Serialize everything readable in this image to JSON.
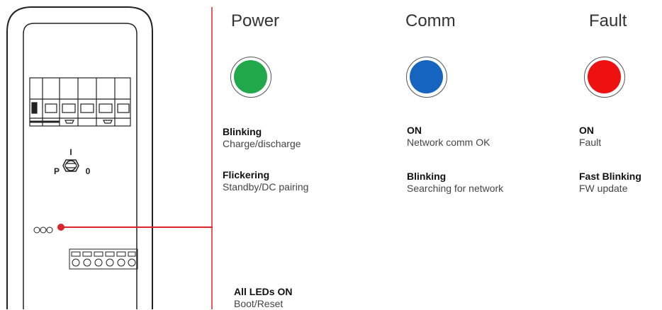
{
  "device": {
    "switch_labels": {
      "top": "I",
      "left": "P",
      "right": "0"
    }
  },
  "columns": [
    {
      "title": "Power",
      "led_color": "#20a84a",
      "states": [
        {
          "heading": "Blinking",
          "desc": "Charge/discharge"
        },
        {
          "heading": "Flickering",
          "desc": "Standby/DC pairing"
        }
      ]
    },
    {
      "title": "Comm",
      "led_color": "#1565c0",
      "states": [
        {
          "heading": "ON",
          "desc": "Network comm OK"
        },
        {
          "heading": "Blinking",
          "desc": "Searching for network"
        }
      ]
    },
    {
      "title": "Fault",
      "led_color": "#ee1111",
      "states": [
        {
          "heading": "ON",
          "desc": "Fault"
        },
        {
          "heading": "Fast Blinking",
          "desc": "FW update"
        }
      ]
    }
  ],
  "all_leds": {
    "heading": "All LEDs ON",
    "desc": "Boot/Reset"
  },
  "colors": {
    "accent_line": "#d9252e",
    "outline": "#222222"
  }
}
